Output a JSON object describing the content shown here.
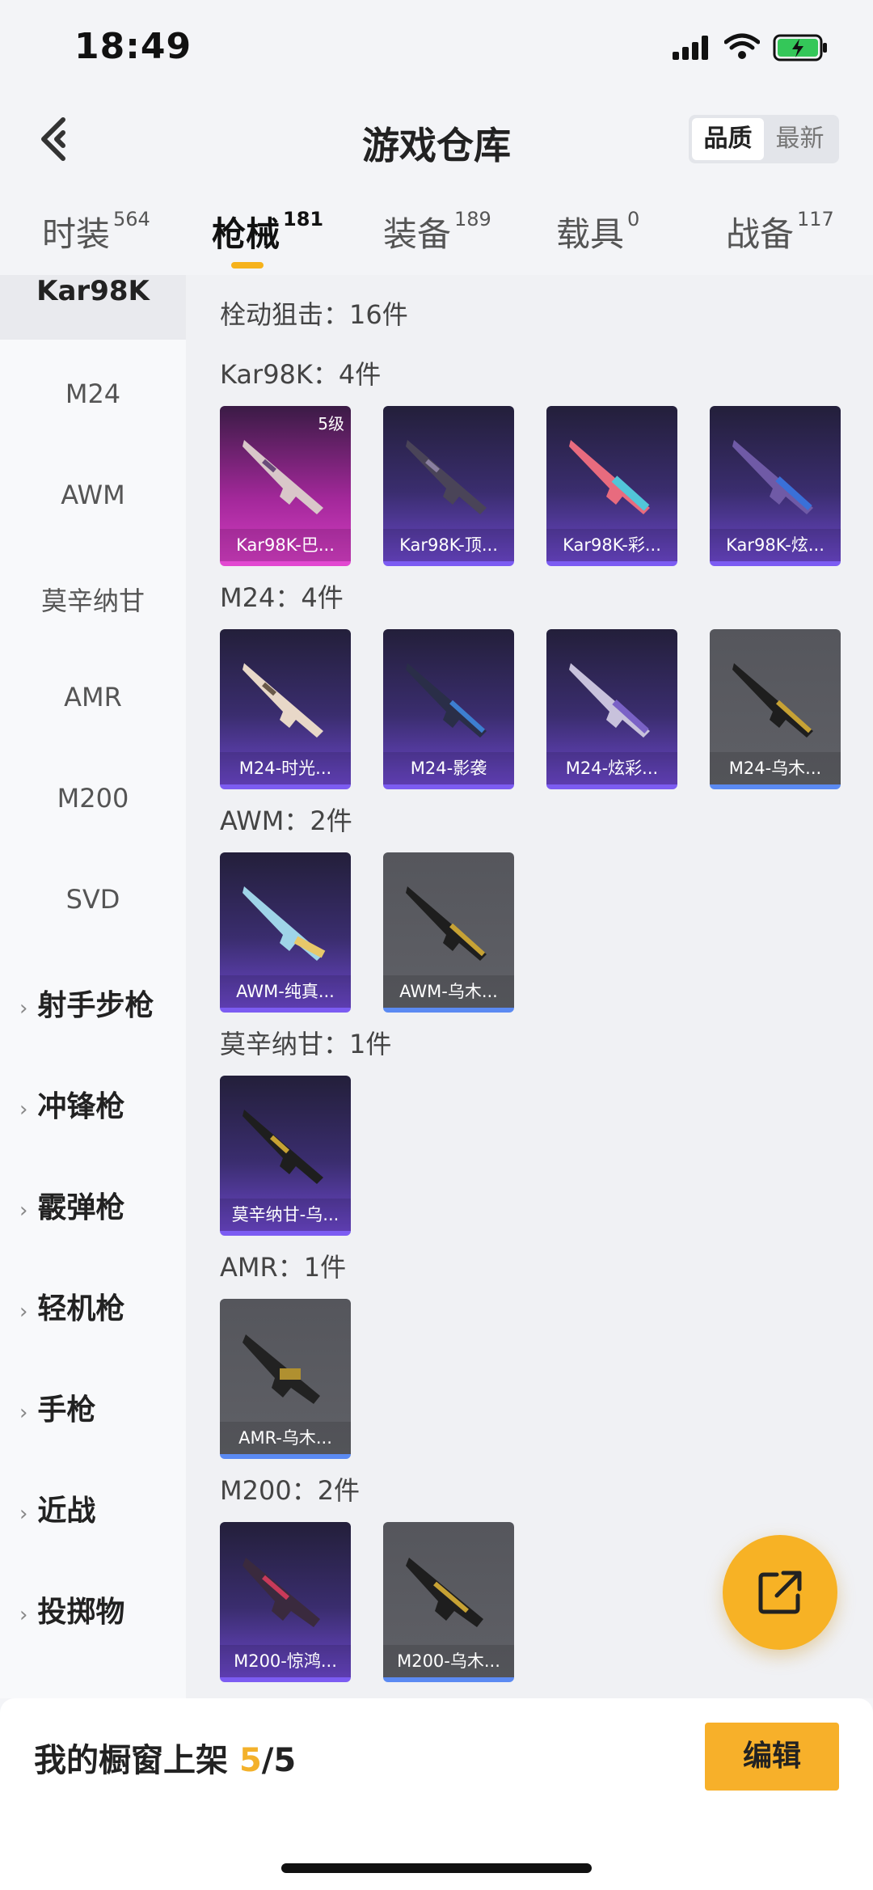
{
  "status": {
    "time": "18:49"
  },
  "header": {
    "title": "游戏仓库",
    "sort_quality": "品质",
    "sort_latest": "最新"
  },
  "tabs": [
    {
      "label": "时装",
      "count": "564"
    },
    {
      "label": "枪械",
      "count": "181"
    },
    {
      "label": "装备",
      "count": "189"
    },
    {
      "label": "载具",
      "count": "0"
    },
    {
      "label": "战备",
      "count": "117"
    }
  ],
  "sidebar": {
    "active": "Kar98K",
    "items": [
      "M24",
      "AWM",
      "莫辛纳甘",
      "AMR",
      "M200",
      "SVD"
    ],
    "groups": [
      "射手步枪",
      "冲锋枪",
      "霰弹枪",
      "轻机枪",
      "手枪",
      "近战",
      "投掷物"
    ]
  },
  "content": {
    "category_label": "栓动狙击：16件",
    "sections": [
      {
        "label": "Kar98K：4件",
        "items": [
          {
            "name": "Kar98K-巴...",
            "level": "5级"
          },
          {
            "name": "Kar98K-顶..."
          },
          {
            "name": "Kar98K-彩..."
          },
          {
            "name": "Kar98K-炫..."
          }
        ]
      },
      {
        "label": "M24：4件",
        "items": [
          {
            "name": "M24-时光..."
          },
          {
            "name": "M24-影袭"
          },
          {
            "name": "M24-炫彩..."
          },
          {
            "name": "M24-乌木..."
          }
        ]
      },
      {
        "label": "AWM：2件",
        "items": [
          {
            "name": "AWM-纯真..."
          },
          {
            "name": "AWM-乌木..."
          }
        ]
      },
      {
        "label": "莫辛纳甘：1件",
        "items": [
          {
            "name": "莫辛纳甘-乌..."
          }
        ]
      },
      {
        "label": "AMR：1件",
        "items": [
          {
            "name": "AMR-乌木..."
          }
        ]
      },
      {
        "label": "M200：2件",
        "items": [
          {
            "name": "M200-惊鸿..."
          },
          {
            "name": "M200-乌木..."
          }
        ]
      }
    ]
  },
  "bottom": {
    "shelf_prefix": "我的橱窗上架 ",
    "shelf_count": "5",
    "shelf_suffix": "/5",
    "edit_label": "编辑"
  },
  "icons": {
    "back": "chevron-left-icon",
    "share": "share-external-icon",
    "signal": "signal-icon",
    "wifi": "wifi-icon",
    "battery": "battery-charging-icon"
  },
  "colors": {
    "accent": "#f7b02a",
    "purple_tier": "#7c5cf2",
    "pink_tier": "#e248d1",
    "grey_tier": "#5b8af2"
  }
}
